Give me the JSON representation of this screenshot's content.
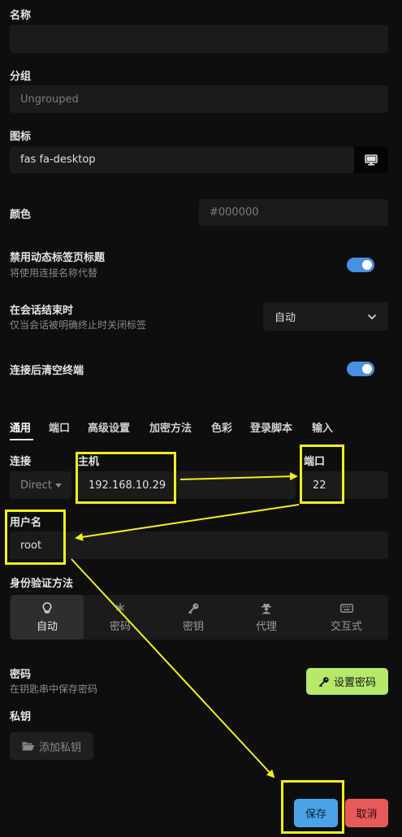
{
  "fields": {
    "name_label": "名称",
    "name_value": "",
    "group_label": "分组",
    "group_placeholder": "Ungrouped",
    "icon_label": "图标",
    "icon_value": "fas fa-desktop",
    "color_label": "颜色",
    "color_placeholder": "#000000"
  },
  "options": {
    "disable_dynamic_title_label": "禁用动态标签页标题",
    "disable_dynamic_title_sub": "将使用连接名称代替",
    "disable_dynamic_title_on": true,
    "close_on_end_label": "在会话结束时",
    "close_on_end_sub": "仅当会话被明确终止时关闭标签",
    "close_on_end_value": "自动",
    "clear_terminal_label": "连接后清空终端",
    "clear_terminal_on": true
  },
  "tabs": [
    {
      "label": "通用",
      "active": true
    },
    {
      "label": "端口"
    },
    {
      "label": "高级设置"
    },
    {
      "label": "加密方法"
    },
    {
      "label": "色彩"
    },
    {
      "label": "登录脚本"
    },
    {
      "label": "输入"
    }
  ],
  "connection": {
    "connect_label": "连接",
    "mode_value": "Direct",
    "host_label": "主机",
    "host_value": "192.168.10.29",
    "port_label": "端口",
    "port_value": "22",
    "username_label": "用户名",
    "username_value": "root"
  },
  "auth": {
    "label": "身份验证方法",
    "options": [
      {
        "label": "自动",
        "icon": "lightbulb-icon",
        "active": true
      },
      {
        "label": "密码",
        "icon": "asterisk-icon"
      },
      {
        "label": "密钥",
        "icon": "key-icon"
      },
      {
        "label": "代理",
        "icon": "user-secret-icon"
      },
      {
        "label": "交互式",
        "icon": "keyboard-icon"
      }
    ]
  },
  "password": {
    "label": "密码",
    "sub": "在钥匙串中保存密码",
    "set_button": "设置密码"
  },
  "private_key": {
    "label": "私钥",
    "add_button": "添加私钥"
  },
  "footer": {
    "save": "保存",
    "cancel": "取消"
  },
  "colors": {
    "accent": "#4a90e2",
    "set_password_bg": "#b5e86b",
    "save_bg": "#4aa3e8",
    "cancel_bg": "#e85a5a",
    "annotation": "#f2ee1c"
  }
}
